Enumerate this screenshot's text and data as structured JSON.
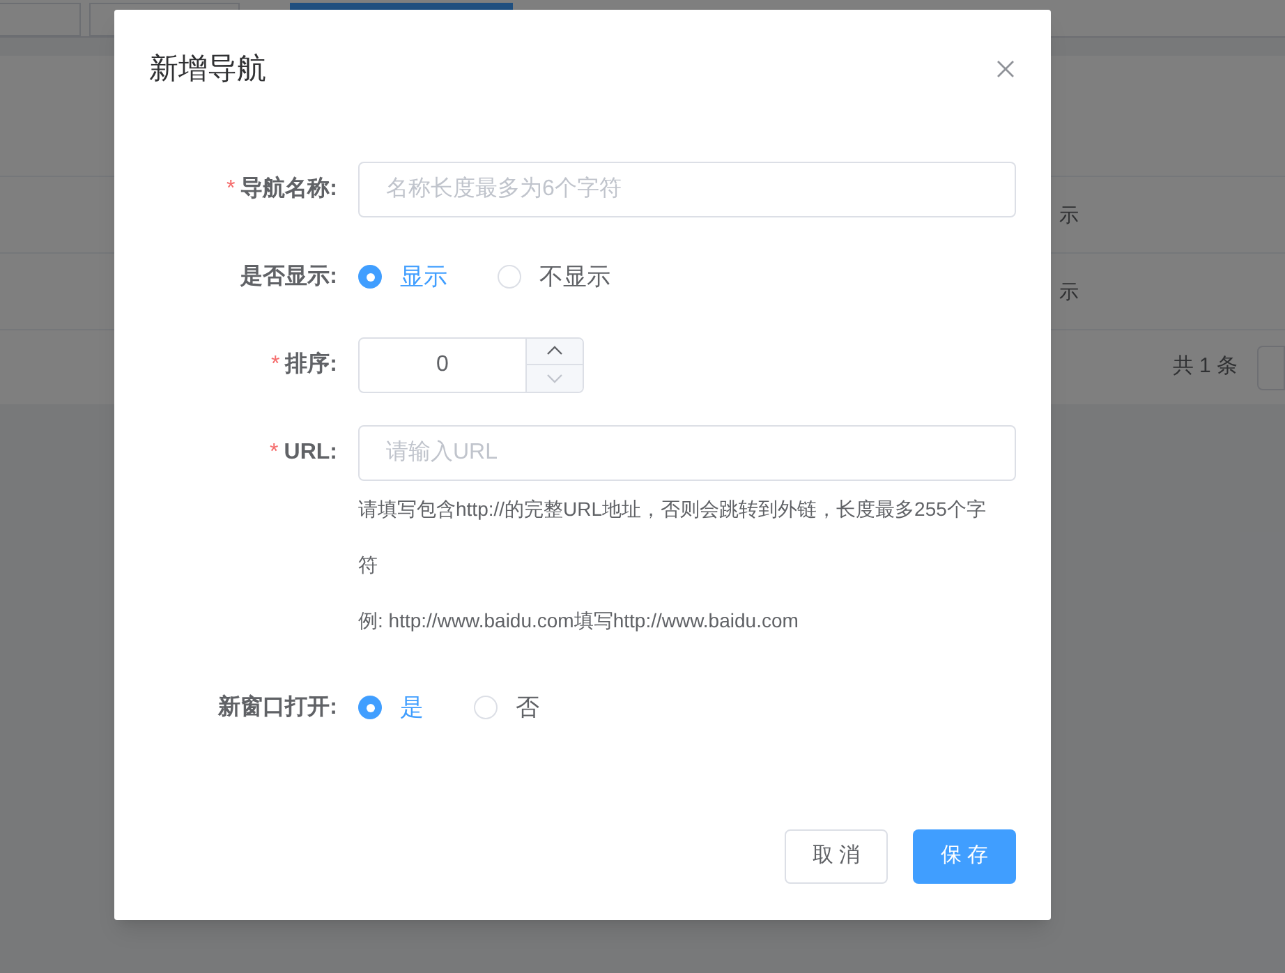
{
  "background": {
    "tabs": [
      {
        "selected": false
      },
      {
        "selected": false
      },
      {
        "selected": true
      }
    ],
    "table_cells": [
      "示",
      "示"
    ],
    "pagination_total": "共 1 条"
  },
  "dialog": {
    "title": "新增导航",
    "required_mark": "*",
    "fields": [
      {
        "kind": "text",
        "label": "导航名称:",
        "required": true,
        "placeholder": "名称长度最多为6个字符"
      },
      {
        "kind": "radio",
        "label": "是否显示:",
        "required": false,
        "options": [
          {
            "label": "显示",
            "selected": true
          },
          {
            "label": "不显示",
            "selected": false
          }
        ]
      },
      {
        "kind": "number",
        "label": "排序:",
        "required": true,
        "value": "0"
      },
      {
        "kind": "text",
        "label": "URL:",
        "required": true,
        "placeholder": "请输入URL",
        "help": [
          "请填写包含http://的完整URL地址，否则会跳转到外链，长度最多255个字符",
          "例: http://www.baidu.com填写http://www.baidu.com"
        ]
      },
      {
        "kind": "radio",
        "label": "新窗口打开:",
        "required": false,
        "options": [
          {
            "label": "是",
            "selected": true
          },
          {
            "label": "否",
            "selected": false
          }
        ]
      }
    ],
    "buttons": [
      {
        "label": "取 消",
        "kind": "secondary"
      },
      {
        "label": "保 存",
        "kind": "primary"
      }
    ]
  }
}
